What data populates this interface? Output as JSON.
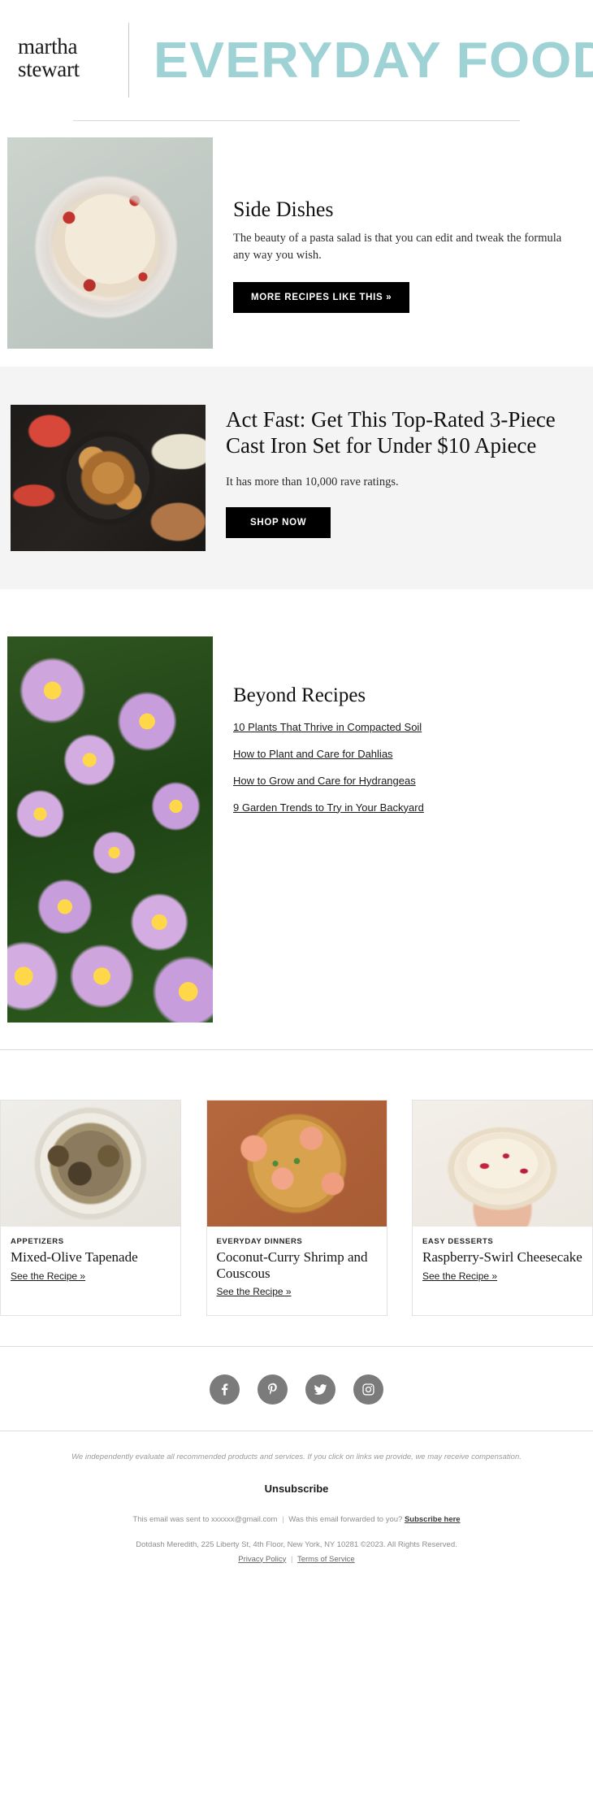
{
  "header": {
    "brand_line1": "martha",
    "brand_line2": "stewart",
    "masthead": "EVERYDAY FOOD",
    "masthead_color": "#9fd2d5"
  },
  "sections": [
    {
      "id": "side-dishes",
      "title": "Side Dishes",
      "description": "The beauty of a pasta salad is that you can edit and tweak the formula any way you wish.",
      "cta_label": "MORE RECIPES LIKE THIS »",
      "image_alt": "pasta-salad-bowl"
    },
    {
      "id": "sponsored",
      "title": "Act Fast: Get This Top-Rated 3-Piece Cast Iron Set for Under $10 Apiece",
      "description": "It has more than 10,000 rave ratings.",
      "cta_label": "SHOP NOW",
      "image_alt": "cast-iron-skillet-chicken-wings",
      "background_color": "#f4f4f4"
    }
  ],
  "beyond": {
    "title": "Beyond Recipes",
    "image_alt": "purple-aster-flowers",
    "links": [
      "10 Plants That Thrive in Compacted Soil",
      "How to Plant and Care for Dahlias",
      "How to Grow and Care for Hydrangeas",
      "9 Garden Trends to Try in Your Backyard"
    ]
  },
  "cards": [
    {
      "kicker": "APPETIZERS",
      "title": "Mixed-Olive Tapenade",
      "link_label": "See the Recipe »",
      "image_alt": "mixed-olive-tapenade-bowl"
    },
    {
      "kicker": "EVERYDAY DINNERS",
      "title": "Coconut-Curry Shrimp and Couscous",
      "link_label": "See the Recipe »",
      "image_alt": "coconut-curry-shrimp-skillet"
    },
    {
      "kicker": "EASY DESSERTS",
      "title": "Raspberry-Swirl Cheesecake",
      "link_label": "See the Recipe »",
      "image_alt": "raspberry-swirl-cheesecake"
    }
  ],
  "social": [
    {
      "name": "facebook",
      "label": "Facebook"
    },
    {
      "name": "pinterest",
      "label": "Pinterest"
    },
    {
      "name": "twitter",
      "label": "Twitter"
    },
    {
      "name": "instagram",
      "label": "Instagram"
    }
  ],
  "footer": {
    "disclaimer": "We independently evaluate all recommended products and services. If you click on links we provide, we may receive compensation.",
    "unsubscribe_label": "Unsubscribe",
    "sent_prefix": "This email was sent to xxxxxx@gmail.com",
    "sent_separator": "|",
    "forwarded_question": "Was this email forwarded to you?",
    "subscribe_label": "Subscribe here",
    "address": "Dotdash Meredith, 225 Liberty St, 4th Floor, New York, NY 10281 ©2023. All Rights Reserved.",
    "privacy_label": "Privacy Policy",
    "legal_separator": "|",
    "terms_label": "Terms of Service"
  }
}
